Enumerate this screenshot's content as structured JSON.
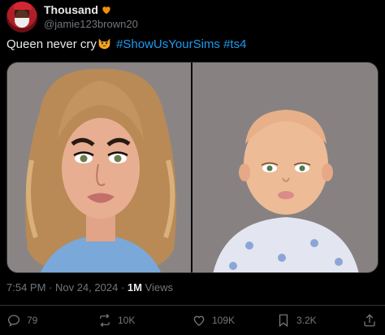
{
  "author": {
    "display_name": "Thousand",
    "handle": "@jamie123brown20"
  },
  "tweet": {
    "text_plain": "Queen never cry",
    "hashtags": [
      "#ShowUsYourSims",
      "#ts4"
    ]
  },
  "meta": {
    "timestamp": "7:54 PM · Nov 24, 2024 · ",
    "views_count": "1M",
    "views_label": " Views"
  },
  "actions": {
    "replies": "79",
    "reposts": "10K",
    "likes": "109K",
    "bookmarks": "3.2K"
  },
  "colors": {
    "accent": "#1d9bf0",
    "heart": "#f4900c",
    "muted": "#71767b"
  }
}
